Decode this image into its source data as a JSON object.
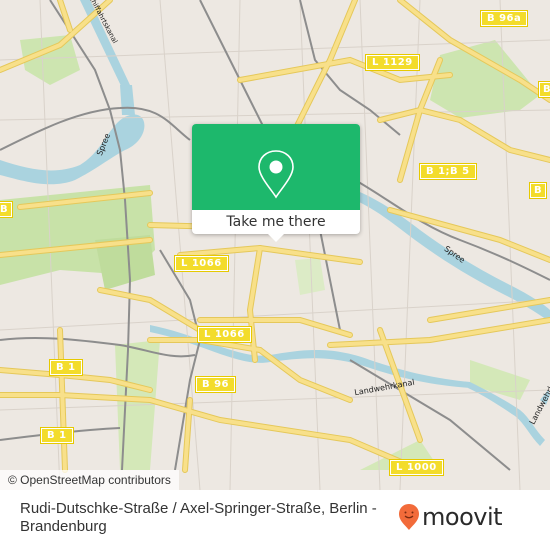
{
  "map": {
    "attribution": "© OpenStreetMap contributors",
    "road_labels": [
      {
        "id": "b96a",
        "text": "B 96a"
      },
      {
        "id": "l1129",
        "text": "L 1129"
      },
      {
        "id": "b1b5",
        "text": "B 1;B 5"
      },
      {
        "id": "b-right1",
        "text": "B"
      },
      {
        "id": "b-right2",
        "text": "B"
      },
      {
        "id": "l1066",
        "text": "L 1066"
      },
      {
        "id": "l1066-top",
        "text": "L 1066"
      },
      {
        "id": "b1-a",
        "text": "B 1"
      },
      {
        "id": "b1-b",
        "text": "B 1"
      },
      {
        "id": "b96",
        "text": "B 96"
      },
      {
        "id": "l1000",
        "text": "L 1000"
      },
      {
        "id": "b-left",
        "text": "B"
      }
    ],
    "water_labels": {
      "spree_west": "Spree",
      "spree_east": "Spree",
      "landwehrkanal": "Landwehrkanal",
      "landwehrkanal_east": "Landwehrk",
      "schifffahrtskanal": "Schiffahrtskanal"
    }
  },
  "popup": {
    "icon": "map-pin-icon",
    "button_label": "Take me there",
    "accent_color": "#1db86c"
  },
  "footer": {
    "location_title": "Rudi-Dutschke-Straße / Axel-Springer-Straße, Berlin - Brandenburg",
    "brand": "moovit",
    "brand_color": "#f26b3a"
  }
}
